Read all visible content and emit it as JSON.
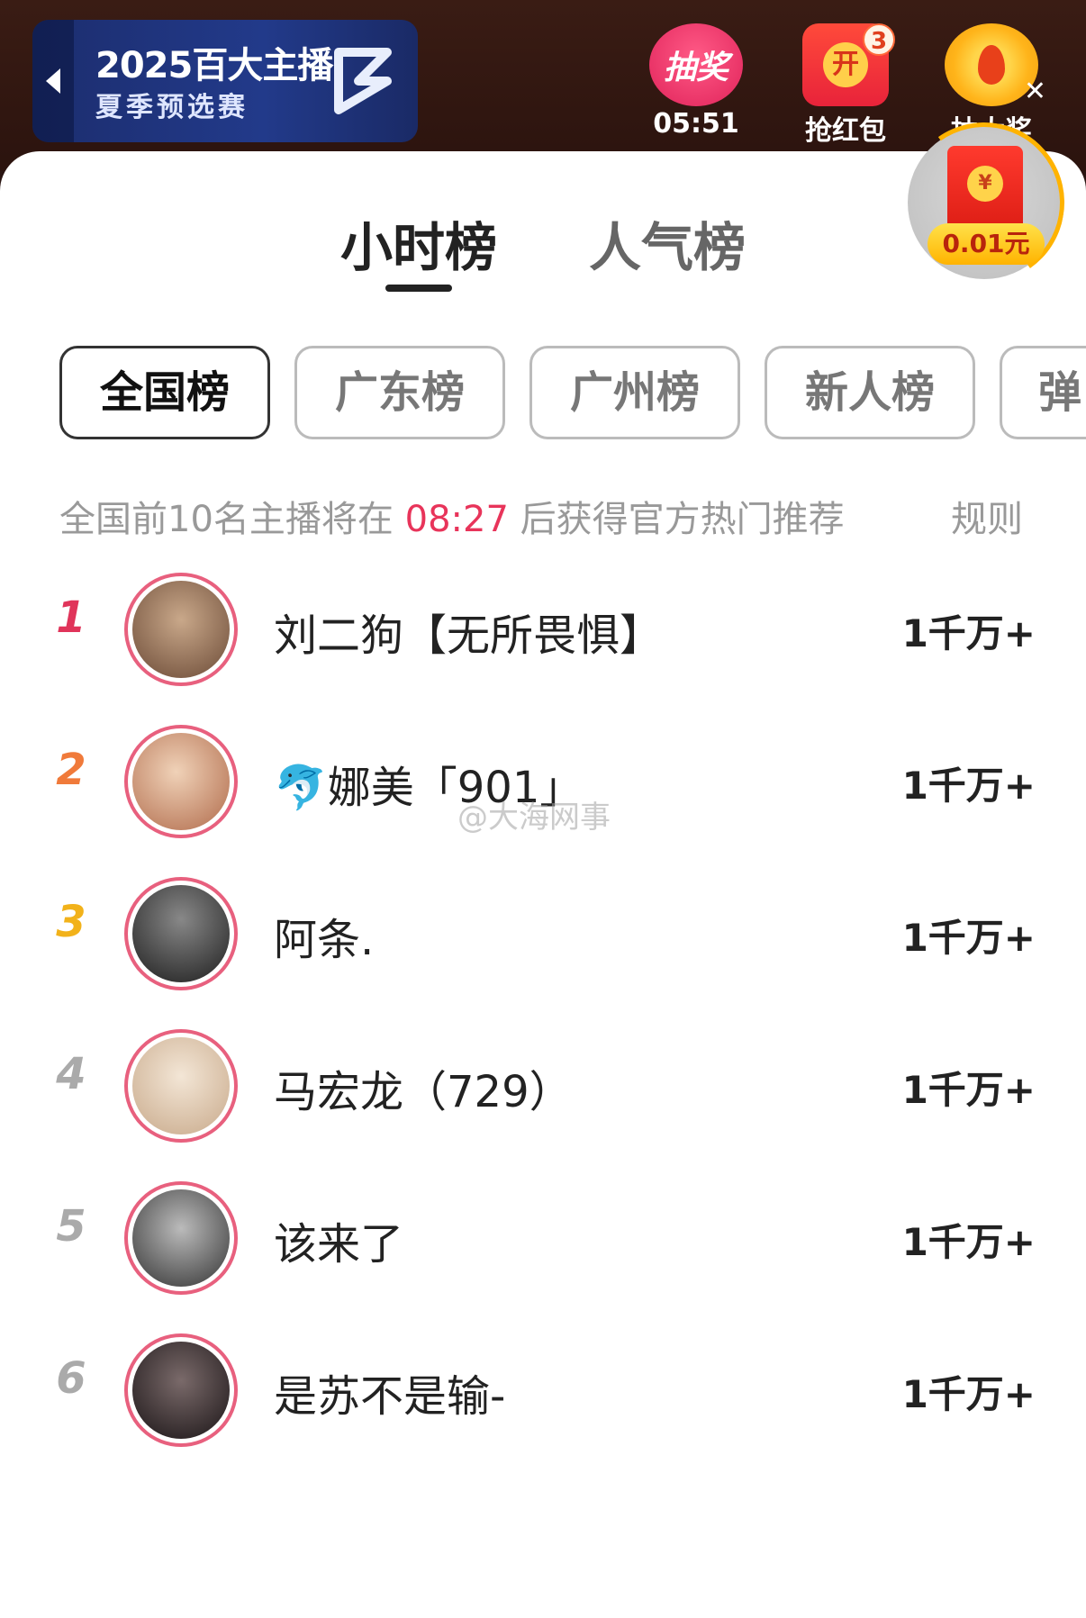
{
  "banner": {
    "title": "2025百大主播",
    "subtitle": "夏季预选赛"
  },
  "actions": [
    {
      "icon_text": "抽奖",
      "label": "05:51"
    },
    {
      "icon_text": "开",
      "label": "抢红包",
      "badge": "3"
    },
    {
      "label": "抽大奖"
    }
  ],
  "redpack": {
    "amount": "0.01元"
  },
  "tabs": [
    {
      "label": "小时榜"
    },
    {
      "label": "人气榜"
    }
  ],
  "filters": [
    {
      "label": "全国榜"
    },
    {
      "label": "广东榜"
    },
    {
      "label": "广州榜"
    },
    {
      "label": "新人榜"
    },
    {
      "label": "弹"
    }
  ],
  "notice": {
    "prefix": "全国前10名主播将在",
    "time": "08:27",
    "suffix": "后获得官方热门推荐",
    "rule": "规则"
  },
  "ranking": [
    {
      "rank": "1",
      "name": "刘二狗【无所畏惧】",
      "score": "1千万+",
      "color": "#e0345a"
    },
    {
      "rank": "2",
      "name": "🐬娜美「901」",
      "score": "1千万+",
      "color": "#f07a3a"
    },
    {
      "rank": "3",
      "name": "阿条.",
      "score": "1千万+",
      "color": "#f2b21a"
    },
    {
      "rank": "4",
      "name": "马宏龙（729）",
      "score": "1千万+",
      "color": "#aaaaaa"
    },
    {
      "rank": "5",
      "name": "该来了",
      "score": "1千万+",
      "color": "#aaaaaa"
    },
    {
      "rank": "6",
      "name": "是苏不是输-",
      "score": "1千万+",
      "color": "#aaaaaa"
    }
  ],
  "watermark": "@大海网事"
}
